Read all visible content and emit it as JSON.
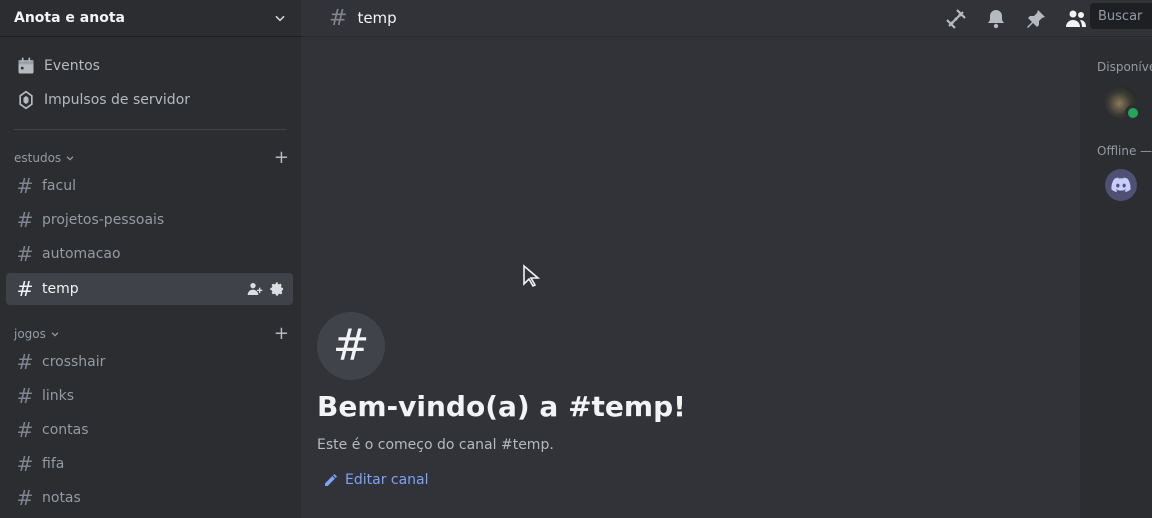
{
  "server": {
    "name": "Anota e anota"
  },
  "top_items": [
    {
      "label": "Eventos",
      "icon": "calendar-icon"
    },
    {
      "label": "Impulsos de servidor",
      "icon": "boost-icon"
    }
  ],
  "categories": [
    {
      "name": "estudos",
      "channels": [
        "facul",
        "projetos-pessoais",
        "automacao",
        "temp"
      ]
    },
    {
      "name": "jogos",
      "channels": [
        "crosshair",
        "links",
        "contas",
        "fifa",
        "notas"
      ]
    }
  ],
  "active_channel": "temp",
  "header": {
    "hash": "#",
    "channel": "temp",
    "search_placeholder": "Buscar"
  },
  "members": {
    "online_label": "Disponível —",
    "offline_label": "Offline —"
  },
  "welcome": {
    "hash": "#",
    "title": "Bem-vindo(a) a #temp!",
    "subtitle": "Este é o começo do canal #temp.",
    "edit_label": "Editar canal"
  },
  "colors": {
    "accent": "#7aa2f7",
    "online": "#23a55a",
    "discord": "#5865f2"
  }
}
